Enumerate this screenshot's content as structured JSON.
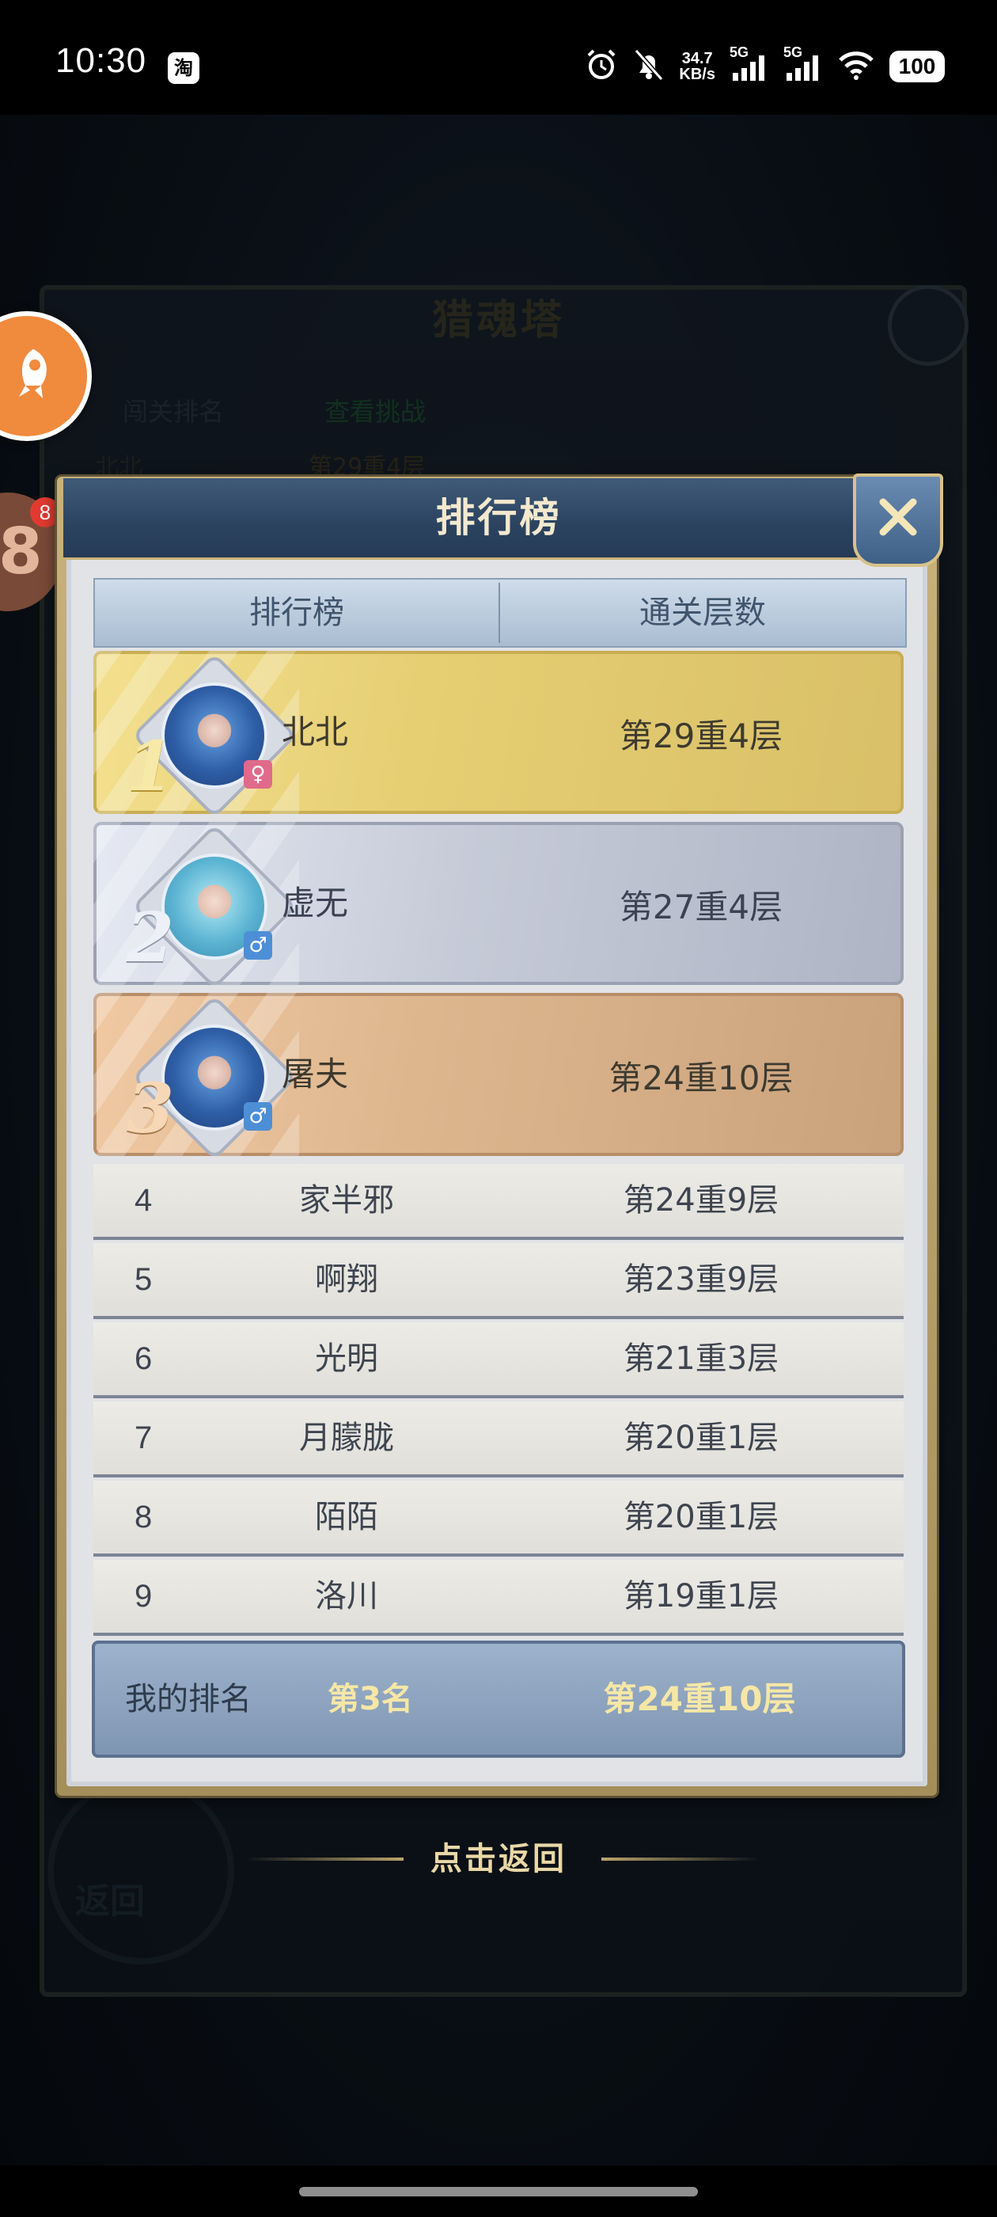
{
  "status_bar": {
    "time": "10:30",
    "app_icon_text": "淘",
    "net_speed_value": "34.7",
    "net_speed_unit": "KB/s",
    "signal_1_label": "5G",
    "signal_2_label": "5G",
    "battery": "100"
  },
  "background": {
    "title": "猎魂塔",
    "tab_a": "闯关排名",
    "tab_b": "查看挑战",
    "row_name": "北北",
    "row_floor": "第29重4层",
    "return_label": "返回"
  },
  "floating": {
    "badge_count": "8",
    "level_digit": "8"
  },
  "modal": {
    "title": "排行榜",
    "header": {
      "col_rank": "排行榜",
      "col_floor": "通关层数"
    },
    "top3": [
      {
        "rank": "1",
        "name": "北北",
        "floor": "第29重4层",
        "gender": "♀"
      },
      {
        "rank": "2",
        "name": "虚无",
        "floor": "第27重4层",
        "gender": "♂"
      },
      {
        "rank": "3",
        "name": "屠夫",
        "floor": "第24重10层",
        "gender": "♂"
      }
    ],
    "rows": [
      {
        "rank": "4",
        "name": "家半邪",
        "floor": "第24重9层"
      },
      {
        "rank": "5",
        "name": "啊翔",
        "floor": "第23重9层"
      },
      {
        "rank": "6",
        "name": "光明",
        "floor": "第21重3层"
      },
      {
        "rank": "7",
        "name": "月朦胧",
        "floor": "第20重1层"
      },
      {
        "rank": "8",
        "name": "陌陌",
        "floor": "第20重1层"
      },
      {
        "rank": "9",
        "name": "洛川",
        "floor": "第19重1层"
      }
    ],
    "my_rank": {
      "label": "我的排名",
      "place": "第3名",
      "floor": "第24重10层"
    }
  },
  "return_hint": "点击返回"
}
